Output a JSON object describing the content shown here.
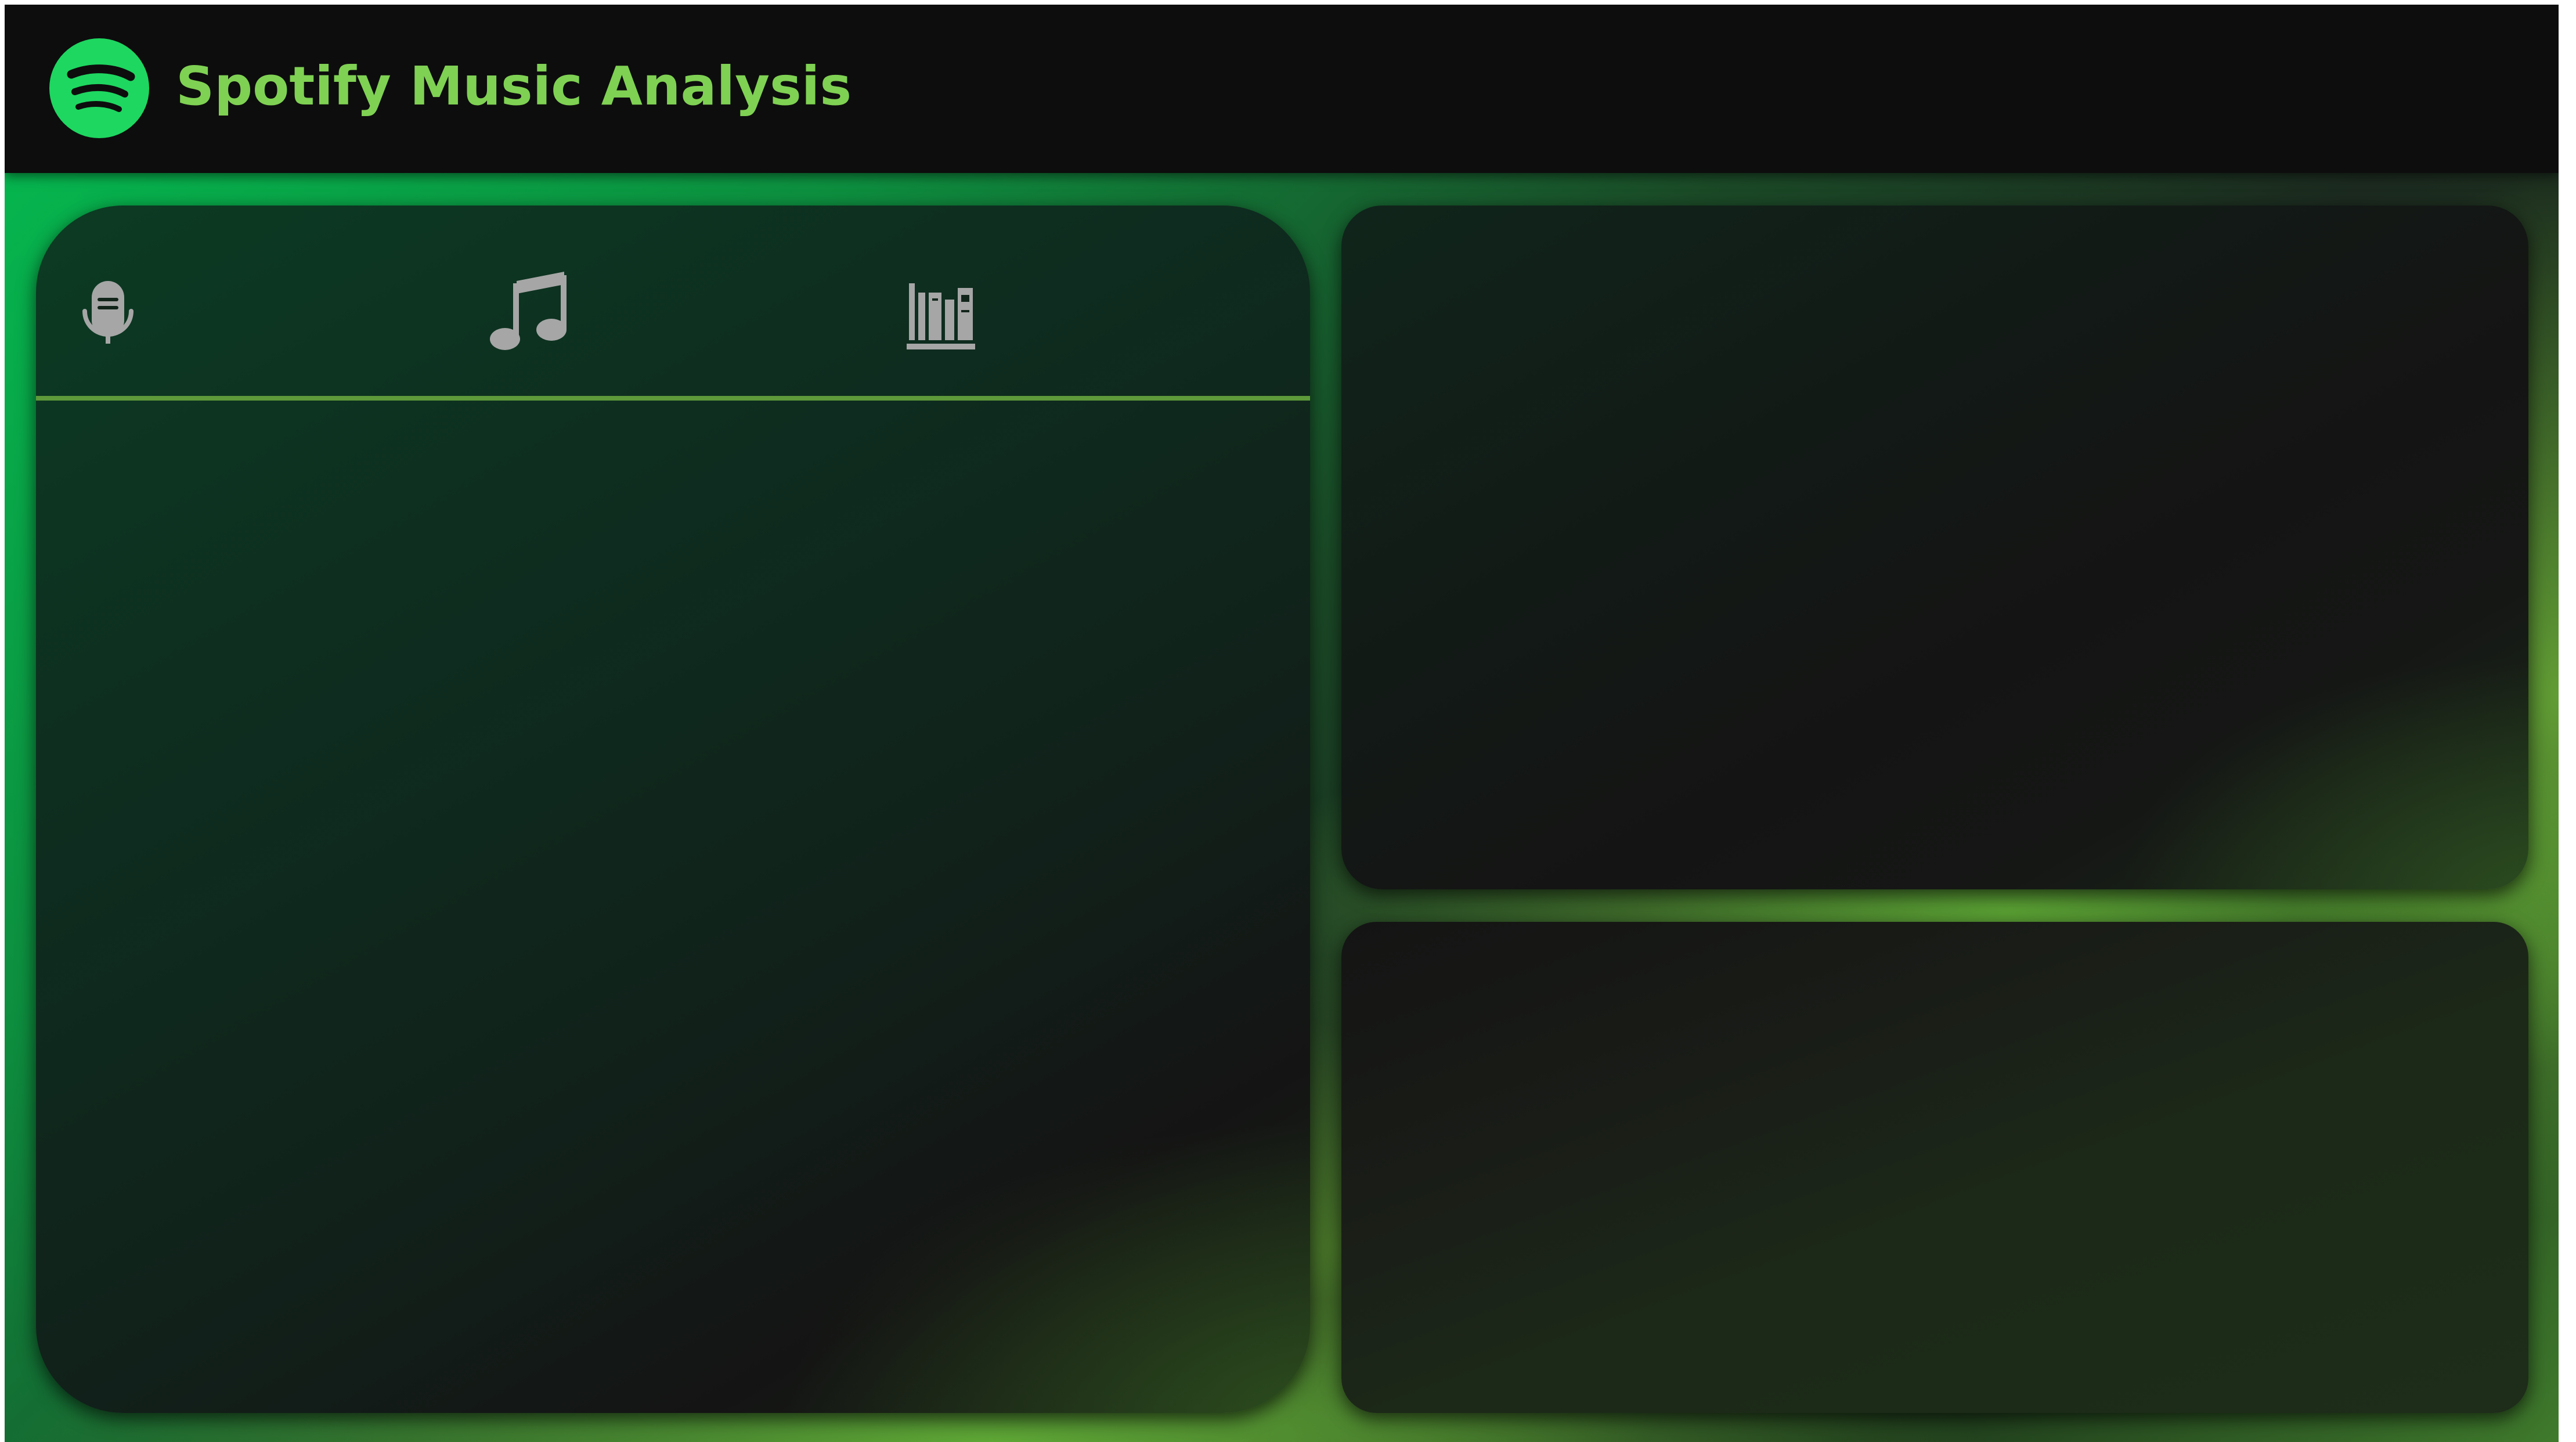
{
  "app": {
    "title": "Spotify Music Analysis",
    "logo_icon": "spotify-logo-icon"
  },
  "colors": {
    "brand_green": "#1ed760",
    "title_green": "#7fd153",
    "header_background": "#0d0d0d",
    "tab_icon_gray": "#a6a6a6",
    "divider_green": "#5e9a3a"
  },
  "tabs": [
    {
      "icon": "podcast-microphone-icon"
    },
    {
      "icon": "music-note-icon"
    },
    {
      "icon": "library-books-icon"
    }
  ]
}
